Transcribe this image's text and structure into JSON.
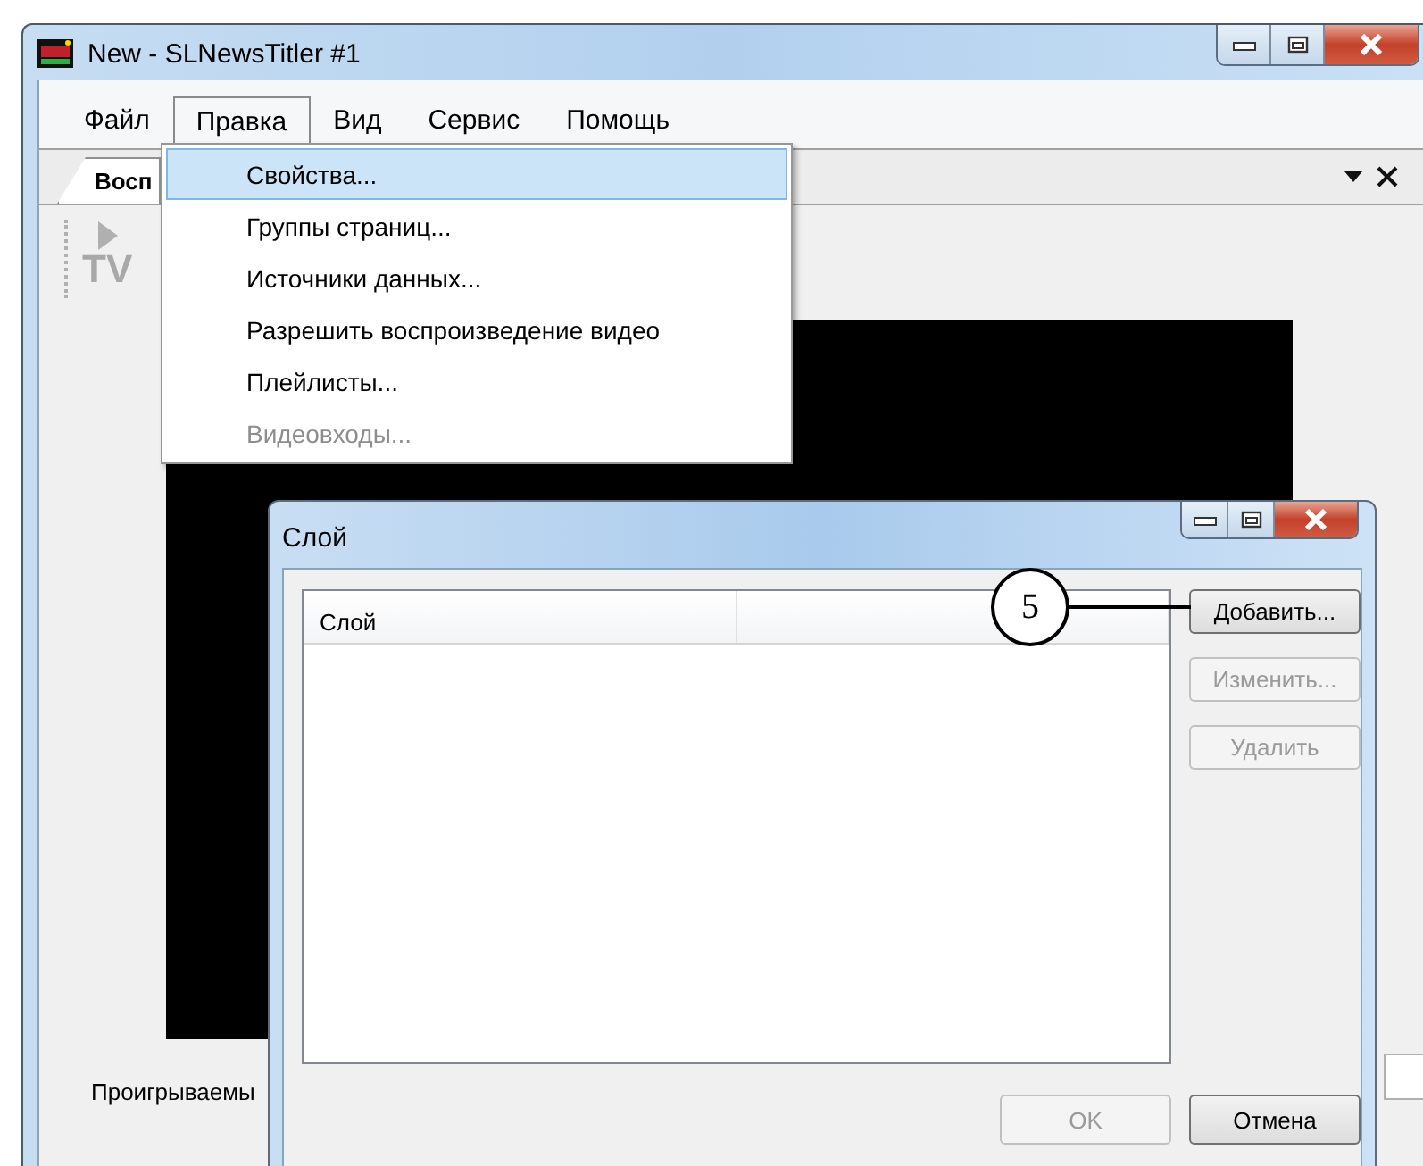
{
  "main_window": {
    "title": "New - SLNewsTitler #1"
  },
  "menu_bar": [
    {
      "label": "Файл",
      "selected": false
    },
    {
      "label": "Правка",
      "selected": true
    },
    {
      "label": "Вид",
      "selected": false
    },
    {
      "label": "Сервис",
      "selected": false
    },
    {
      "label": "Помощь",
      "selected": false
    }
  ],
  "menu": {
    "items": [
      {
        "label": "Свойства...",
        "selected": true,
        "disabled": false
      },
      {
        "label": "Группы страниц...",
        "selected": false,
        "disabled": false
      },
      {
        "label": "Источники данных...",
        "selected": false,
        "disabled": false
      },
      {
        "label": "Разрешить воспроизведение видео",
        "selected": false,
        "disabled": false
      },
      {
        "label": "Плейлисты...",
        "selected": false,
        "disabled": false
      },
      {
        "label": "Видеовходы...",
        "selected": false,
        "disabled": true
      }
    ]
  },
  "tab": {
    "label": "Восп"
  },
  "toolbar": {
    "icon_label": "TV"
  },
  "preview_label": "Проигрываемы",
  "dialog": {
    "title": "Слой",
    "list": {
      "columns": [
        "Слой"
      ]
    },
    "buttons": [
      {
        "label": "Добавить...",
        "disabled": false
      },
      {
        "label": "Изменить...",
        "disabled": true
      },
      {
        "label": "Удалить",
        "disabled": true
      }
    ],
    "footer_buttons": [
      {
        "label": "OK",
        "disabled": true
      },
      {
        "label": "Отмена",
        "disabled": false
      }
    ]
  },
  "callout": {
    "label": "5"
  }
}
